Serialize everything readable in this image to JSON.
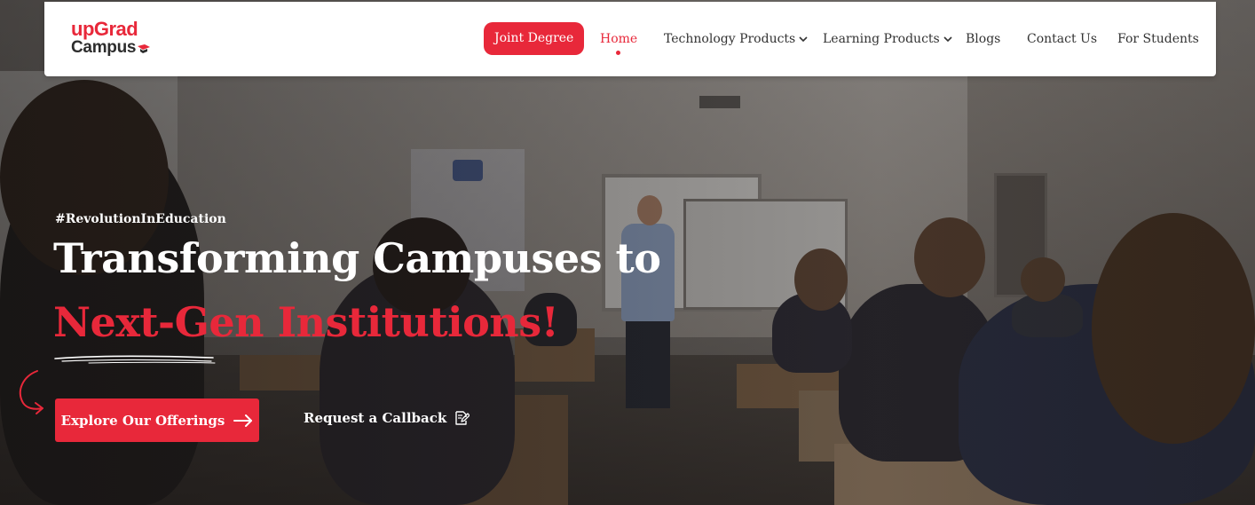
{
  "brand": {
    "logo_line1": "upGrad",
    "logo_line2": "Campus",
    "accent_color": "#e8283a"
  },
  "nav": {
    "joint_degree": "Joint Degree",
    "items": [
      {
        "label": "Home",
        "active": true
      },
      {
        "label": "Technology Products",
        "dropdown": true
      },
      {
        "label": "Learning Products",
        "dropdown": true
      },
      {
        "label": "Blogs"
      },
      {
        "label": "Contact Us"
      },
      {
        "label": "For Students"
      }
    ]
  },
  "hero": {
    "hashtag": "#RevolutionInEducation",
    "headline_line1": "Transforming Campuses to",
    "headline_line2": "Next-Gen Institutions!",
    "primary_cta": "Explore Our Offerings",
    "primary_cta_icon": "arrow-right-icon",
    "secondary_cta": "Request a Callback",
    "secondary_cta_icon": "edit-icon"
  }
}
